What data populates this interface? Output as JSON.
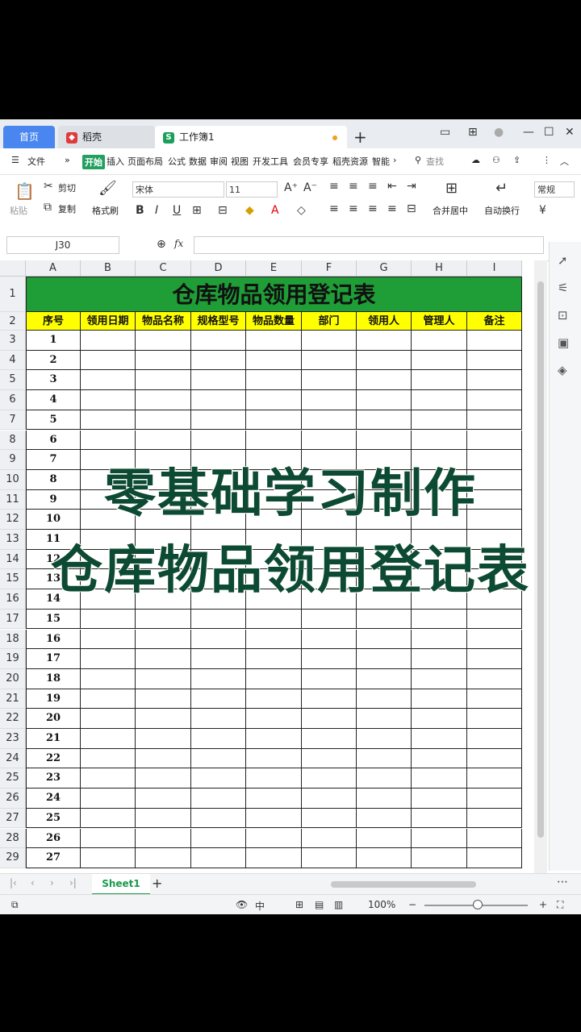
{
  "titlebar": {
    "home_tab": "首页",
    "tab_docer": "稻壳",
    "tab_workbook": "工作簿1",
    "new_tab": "+"
  },
  "menu": {
    "file": "文件",
    "items": [
      "开始",
      "插入",
      "页面布局",
      "公式",
      "数据",
      "审阅",
      "视图",
      "开发工具",
      "会员专享",
      "稻壳资源",
      "智能"
    ],
    "search": "查找"
  },
  "ribbon": {
    "paste": "粘贴",
    "cut": "剪切",
    "copy": "复制",
    "format_painter": "格式刷",
    "font_name": "宋体",
    "font_size": "11",
    "merge_center": "合并居中",
    "wrap_text": "自动换行",
    "number_format": "常规"
  },
  "formula_bar": {
    "name_box": "J30",
    "fx": "fx",
    "value": ""
  },
  "columns": [
    "A",
    "B",
    "C",
    "D",
    "E",
    "F",
    "G",
    "H",
    "I"
  ],
  "sheet": {
    "title": "仓库物品领用登记表",
    "headers": [
      "序号",
      "领用日期",
      "物品名称",
      "规格型号",
      "物品数量",
      "部门",
      "领用人",
      "管理人",
      "备注"
    ],
    "row_numbers": [
      "1",
      "2",
      "3",
      "4",
      "5",
      "6",
      "7",
      "8",
      "9",
      "10",
      "11",
      "12",
      "13",
      "14",
      "15",
      "16",
      "17",
      "18",
      "19",
      "20",
      "21",
      "22",
      "23",
      "24",
      "25",
      "26",
      "27",
      "28",
      "29"
    ],
    "serials": [
      "1",
      "2",
      "3",
      "4",
      "5",
      "6",
      "7",
      "8",
      "9",
      "10",
      "11",
      "12",
      "13",
      "14",
      "15",
      "16",
      "17",
      "18",
      "19",
      "20",
      "21",
      "22",
      "23",
      "24",
      "25",
      "26",
      "27"
    ]
  },
  "overlay": {
    "line1": "零基础学习制作",
    "line2": "仓库物品领用登记表"
  },
  "sheet_tabs": {
    "active": "Sheet1",
    "add": "+"
  },
  "status": {
    "zoom": "100%"
  },
  "colors": {
    "title_green": "#1f9d36",
    "header_yellow": "#ffff00",
    "active_tab_green": "#1a9a4a"
  }
}
